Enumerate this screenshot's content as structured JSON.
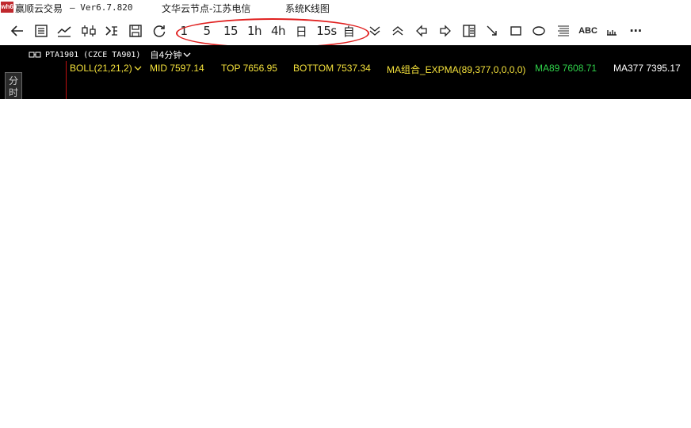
{
  "titlebar": {
    "logo_text": "wh6",
    "app_name": "赢顺云交易",
    "version": "–  Ver6.7.820",
    "node": "文华云节点-江苏电信",
    "system": "系统K线图"
  },
  "toolbar": {
    "items": [
      {
        "name": "back-arrow-icon",
        "label": ""
      },
      {
        "name": "quote-list-icon",
        "label": ""
      },
      {
        "name": "line-chart-icon",
        "label": ""
      },
      {
        "name": "candlestick-icon",
        "label": ""
      },
      {
        "name": "signal-icon",
        "label": ""
      },
      {
        "name": "save-icon",
        "label": ""
      },
      {
        "name": "refresh-icon",
        "label": ""
      },
      {
        "name": "period-1min",
        "label": "1"
      },
      {
        "name": "period-5min",
        "label": "5"
      },
      {
        "name": "period-15min",
        "label": "15"
      },
      {
        "name": "period-1h",
        "label": "1h"
      },
      {
        "name": "period-4h",
        "label": "4h"
      },
      {
        "name": "period-day",
        "label": "日"
      },
      {
        "name": "period-15s",
        "label": "15s"
      },
      {
        "name": "period-custom",
        "label": "自"
      },
      {
        "name": "zoom-out-icon",
        "label": ""
      },
      {
        "name": "zoom-in-icon",
        "label": ""
      },
      {
        "name": "scroll-left-icon",
        "label": ""
      },
      {
        "name": "scroll-right-icon",
        "label": ""
      },
      {
        "name": "layout-panel-icon",
        "label": ""
      },
      {
        "name": "draw-line-icon",
        "label": ""
      },
      {
        "name": "draw-rectangle-icon",
        "label": ""
      },
      {
        "name": "draw-ellipse-icon",
        "label": ""
      },
      {
        "name": "text-lines-icon",
        "label": ""
      },
      {
        "name": "text-tool",
        "label": "ABC"
      },
      {
        "name": "ruler-icon",
        "label": ""
      },
      {
        "name": "more-icon",
        "label": "···"
      }
    ]
  },
  "chart": {
    "symbol": "PTA1901 (CZCE TA901)",
    "period": "自4分钟",
    "side_tab": "分时",
    "indicators": {
      "boll": "BOLL(21,21,2)",
      "mid": "MID 7597.14",
      "top": "TOP 7656.95",
      "bottom": "BOTTOM 7537.34",
      "ma_group": "MA组合_EXPMA(89,377,0,0,0,0)",
      "ma89": "MA89 7608.71",
      "ma377": "MA377 7395.17"
    }
  },
  "colors": {
    "chart_bg": "#000000",
    "indicator_yellow": "#f5e23b",
    "ma89_green": "#2fd34a",
    "annotation_red": "#e0201f"
  }
}
